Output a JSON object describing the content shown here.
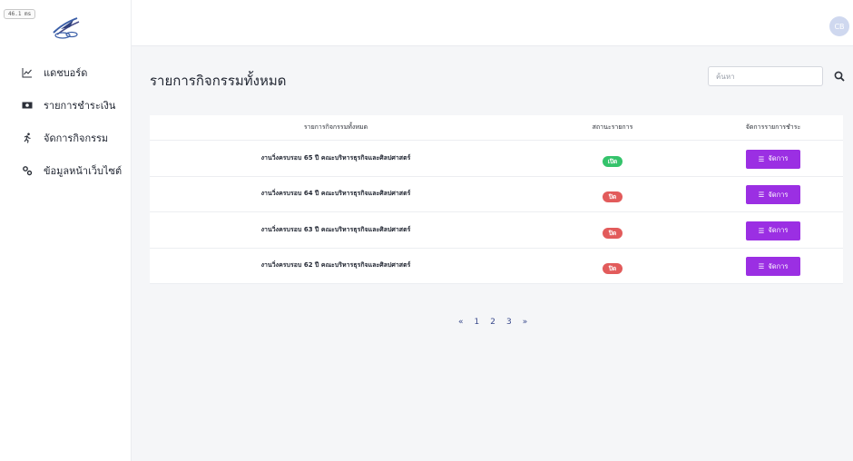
{
  "perf_badge": "46.1 ms",
  "sidebar": {
    "items": [
      {
        "label": "แดชบอร์ด",
        "icon": "chart-line-icon"
      },
      {
        "label": "รายการชำระเงิน",
        "icon": "money-bill-icon"
      },
      {
        "label": "จัดการกิจกรรม",
        "icon": "running-person-icon"
      },
      {
        "label": "ข้อมูลหน้าเว็บไซต์",
        "icon": "gears-icon"
      }
    ]
  },
  "topbar": {
    "avatar_initials": "CB"
  },
  "main": {
    "title": "รายการกิจกรรมทั้งหมด",
    "search": {
      "placeholder": "ค้นหา",
      "value": ""
    }
  },
  "table": {
    "headers": [
      "รายการกิจกรรมทั้งหมด",
      "สถานะรายการ",
      "จัดการรายการชำระ"
    ],
    "rows": [
      {
        "name": "งานวิ่งครบรอบ 65 ปี คณะบริหารธุรกิจและศิลปศาสตร์",
        "status": "เปิด",
        "status_type": "open",
        "action": "จัดการ"
      },
      {
        "name": "งานวิ่งครบรอบ 64 ปี คณะบริหารธุรกิจและศิลปศาสตร์",
        "status": "ปิด",
        "status_type": "closed",
        "action": "จัดการ"
      },
      {
        "name": "งานวิ่งครบรอบ 63 ปี คณะบริหารธุรกิจและศิลปศาสตร์",
        "status": "ปิด",
        "status_type": "closed",
        "action": "จัดการ"
      },
      {
        "name": "งานวิ่งครบรอบ 62 ปี คณะบริหารธุรกิจและศิลปศาสตร์",
        "status": "ปิด",
        "status_type": "closed",
        "action": "จัดการ"
      }
    ]
  },
  "pagination": {
    "prev": "«",
    "pages": [
      "1",
      "2",
      "3"
    ],
    "next": "»"
  },
  "colors": {
    "accent": "#9b2fe3",
    "status_open": "#34c36b",
    "status_closed": "#e25b5b",
    "background": "#f5f6f8"
  }
}
